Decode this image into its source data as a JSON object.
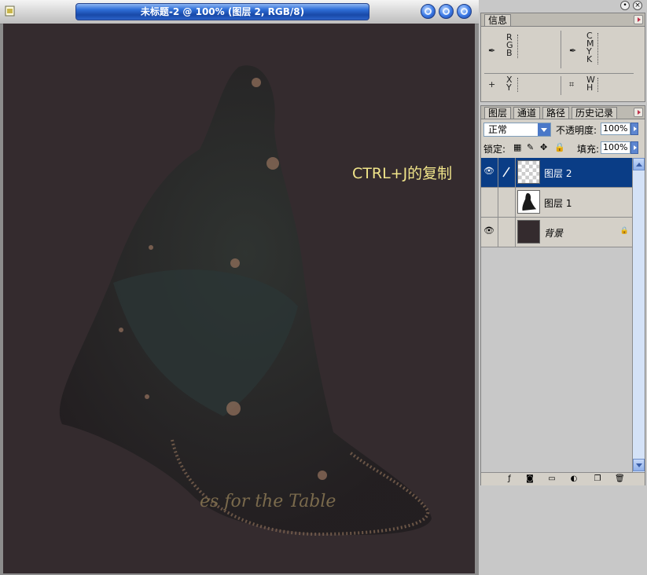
{
  "window": {
    "title": "未标题-2 @ 100% (图层 2, RGB/8)"
  },
  "canvas": {
    "background_color": "#342b2e",
    "annotation": "CTRL+J的复制",
    "annotation_color": "#f1e58a",
    "overlay_text": "es for the Table"
  },
  "info_panel": {
    "tab": "信息",
    "rgb_labels": [
      "R",
      "G",
      "B"
    ],
    "cmyk_labels": [
      "C",
      "M",
      "Y",
      "K"
    ],
    "xy_labels": [
      "X",
      "Y"
    ],
    "wh_labels": [
      "W",
      "H"
    ]
  },
  "layers_panel": {
    "tabs": [
      "图层",
      "通道",
      "路径",
      "历史记录"
    ],
    "blend_mode": "正常",
    "opacity_label": "不透明度:",
    "opacity_value": "100%",
    "lock_label": "锁定:",
    "fill_label": "填充:",
    "fill_value": "100%",
    "layers": [
      {
        "name": "图层 2",
        "visible": true,
        "selected": true
      },
      {
        "name": "图层 1",
        "visible": false,
        "selected": false
      },
      {
        "name": "背景",
        "visible": true,
        "selected": false,
        "locked": true
      }
    ]
  },
  "icons": {
    "eyedropper": "eyedropper-icon",
    "crosshair": "crosshair-icon",
    "eye": "eye-icon",
    "brush": "brush-icon",
    "lock": "lock-icon"
  },
  "colors": {
    "selected_layer": "#0a3d86",
    "title_bar": "#1849a8"
  }
}
